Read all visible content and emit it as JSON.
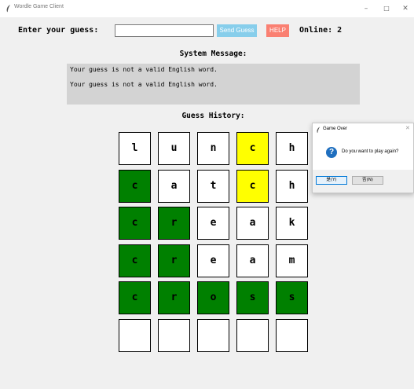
{
  "window": {
    "title": "Wordle Game Client",
    "minimize": "–",
    "maximize": "□",
    "close": "✕"
  },
  "controls": {
    "guess_label": "Enter your guess:",
    "guess_value": "",
    "send_label": "Send Guess",
    "help_label": "HELP",
    "online_text": "Online: 2",
    "send_color": "#87ceeb",
    "help_color": "#fa8072"
  },
  "system": {
    "title": "System Message:",
    "messages": [
      "Your guess is not a valid English word.",
      "Your guess is not a valid English word."
    ]
  },
  "history": {
    "title": "Guess History:",
    "colors": {
      "green": "#008000",
      "yellow": "#ffff00",
      "white": "#ffffff"
    },
    "rows": [
      [
        {
          "letter": "l",
          "state": "white"
        },
        {
          "letter": "u",
          "state": "white"
        },
        {
          "letter": "n",
          "state": "white"
        },
        {
          "letter": "c",
          "state": "yellow"
        },
        {
          "letter": "h",
          "state": "white"
        }
      ],
      [
        {
          "letter": "c",
          "state": "green"
        },
        {
          "letter": "a",
          "state": "white"
        },
        {
          "letter": "t",
          "state": "white"
        },
        {
          "letter": "c",
          "state": "yellow"
        },
        {
          "letter": "h",
          "state": "white"
        }
      ],
      [
        {
          "letter": "c",
          "state": "green"
        },
        {
          "letter": "r",
          "state": "green"
        },
        {
          "letter": "e",
          "state": "white"
        },
        {
          "letter": "a",
          "state": "white"
        },
        {
          "letter": "k",
          "state": "white"
        }
      ],
      [
        {
          "letter": "c",
          "state": "green"
        },
        {
          "letter": "r",
          "state": "green"
        },
        {
          "letter": "e",
          "state": "white"
        },
        {
          "letter": "a",
          "state": "white"
        },
        {
          "letter": "m",
          "state": "white"
        }
      ],
      [
        {
          "letter": "c",
          "state": "green"
        },
        {
          "letter": "r",
          "state": "green"
        },
        {
          "letter": "o",
          "state": "green"
        },
        {
          "letter": "s",
          "state": "green"
        },
        {
          "letter": "s",
          "state": "green"
        }
      ],
      [
        {
          "letter": "",
          "state": "empty"
        },
        {
          "letter": "",
          "state": "empty"
        },
        {
          "letter": "",
          "state": "empty"
        },
        {
          "letter": "",
          "state": "empty"
        },
        {
          "letter": "",
          "state": "empty"
        }
      ]
    ]
  },
  "dialog": {
    "title": "Game Over",
    "close": "✕",
    "icon": "question-icon",
    "icon_glyph": "?",
    "message": "Do you want to play again?",
    "yes_label": "是(Y)",
    "no_label": "否(N)"
  }
}
